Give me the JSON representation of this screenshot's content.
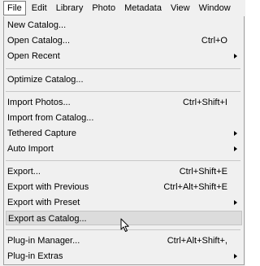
{
  "menubar": {
    "items": [
      "File",
      "Edit",
      "Library",
      "Photo",
      "Metadata",
      "View",
      "Window"
    ]
  },
  "file_menu": {
    "items": [
      {
        "label": "New Catalog...",
        "shortcut": ""
      },
      {
        "label": "Open Catalog...",
        "shortcut": "Ctrl+O"
      },
      {
        "label": "Open Recent",
        "shortcut": "",
        "submenu": true
      },
      {
        "label": "Optimize Catalog...",
        "shortcut": ""
      },
      {
        "label": "Import Photos...",
        "shortcut": "Ctrl+Shift+I"
      },
      {
        "label": "Import from Catalog...",
        "shortcut": ""
      },
      {
        "label": "Tethered Capture",
        "shortcut": "",
        "submenu": true
      },
      {
        "label": "Auto Import",
        "shortcut": "",
        "submenu": true
      },
      {
        "label": "Export...",
        "shortcut": "Ctrl+Shift+E"
      },
      {
        "label": "Export with Previous",
        "shortcut": "Ctrl+Alt+Shift+E"
      },
      {
        "label": "Export with Preset",
        "shortcut": "",
        "submenu": true
      },
      {
        "label": "Export as Catalog...",
        "shortcut": "",
        "highlighted": true
      },
      {
        "label": "Plug-in Manager...",
        "shortcut": "Ctrl+Alt+Shift+,"
      },
      {
        "label": "Plug-in Extras",
        "shortcut": "",
        "submenu": true
      }
    ]
  },
  "icons": {
    "submenu": "chevron-right-icon",
    "cursor": "mouse-pointer-icon"
  },
  "colors": {
    "menu_background": "#f0f0f0",
    "highlight_background": "#dcdcdc"
  }
}
